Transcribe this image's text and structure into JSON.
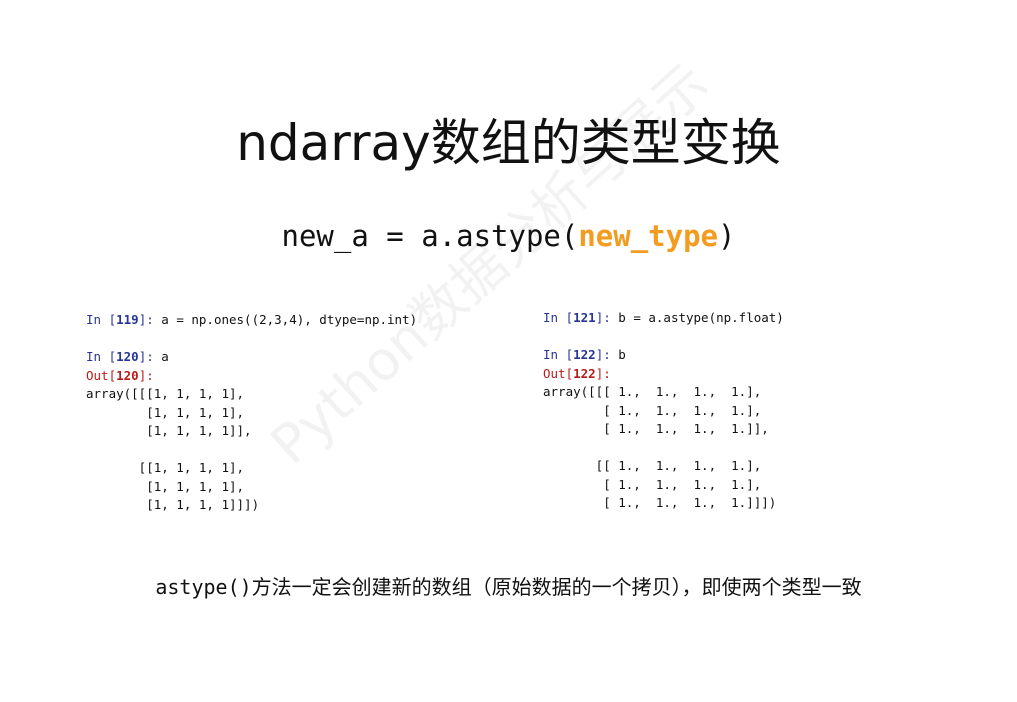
{
  "title": "ndarray数组的类型变换",
  "formula": {
    "prefix": "new_a = a.astype(",
    "param": "new_type",
    "suffix": ")"
  },
  "code_left": {
    "in1_prompt": "In [",
    "in1_num": "119",
    "in1_close": "]: ",
    "in1_code": "a = np.ones((2,3,4), dtype=np.int)",
    "in2_prompt": "In [",
    "in2_num": "120",
    "in2_close": "]: ",
    "in2_code": "a",
    "out_prompt": "Out[",
    "out_num": "120",
    "out_close": "]:",
    "output_lines": [
      "array([[[1, 1, 1, 1],",
      "        [1, 1, 1, 1],",
      "        [1, 1, 1, 1]],",
      "",
      "       [[1, 1, 1, 1],",
      "        [1, 1, 1, 1],",
      "        [1, 1, 1, 1]]])"
    ]
  },
  "code_right": {
    "in1_prompt": "In [",
    "in1_num": "121",
    "in1_close": "]: ",
    "in1_code": "b = a.astype(np.float)",
    "in2_prompt": "In [",
    "in2_num": "122",
    "in2_close": "]: ",
    "in2_code": "b",
    "out_prompt": "Out[",
    "out_num": "122",
    "out_close": "]:",
    "output_lines": [
      "array([[[ 1.,  1.,  1.,  1.],",
      "        [ 1.,  1.,  1.,  1.],",
      "        [ 1.,  1.,  1.,  1.]],",
      "",
      "       [[ 1.,  1.,  1.,  1.],",
      "        [ 1.,  1.,  1.,  1.],",
      "        [ 1.,  1.,  1.,  1.]]])"
    ]
  },
  "note": {
    "code": "astype()",
    "text": "方法一定会创建新的数组（原始数据的一个拷贝），即使两个类型一致"
  },
  "watermark": "Python数据分析与展示"
}
